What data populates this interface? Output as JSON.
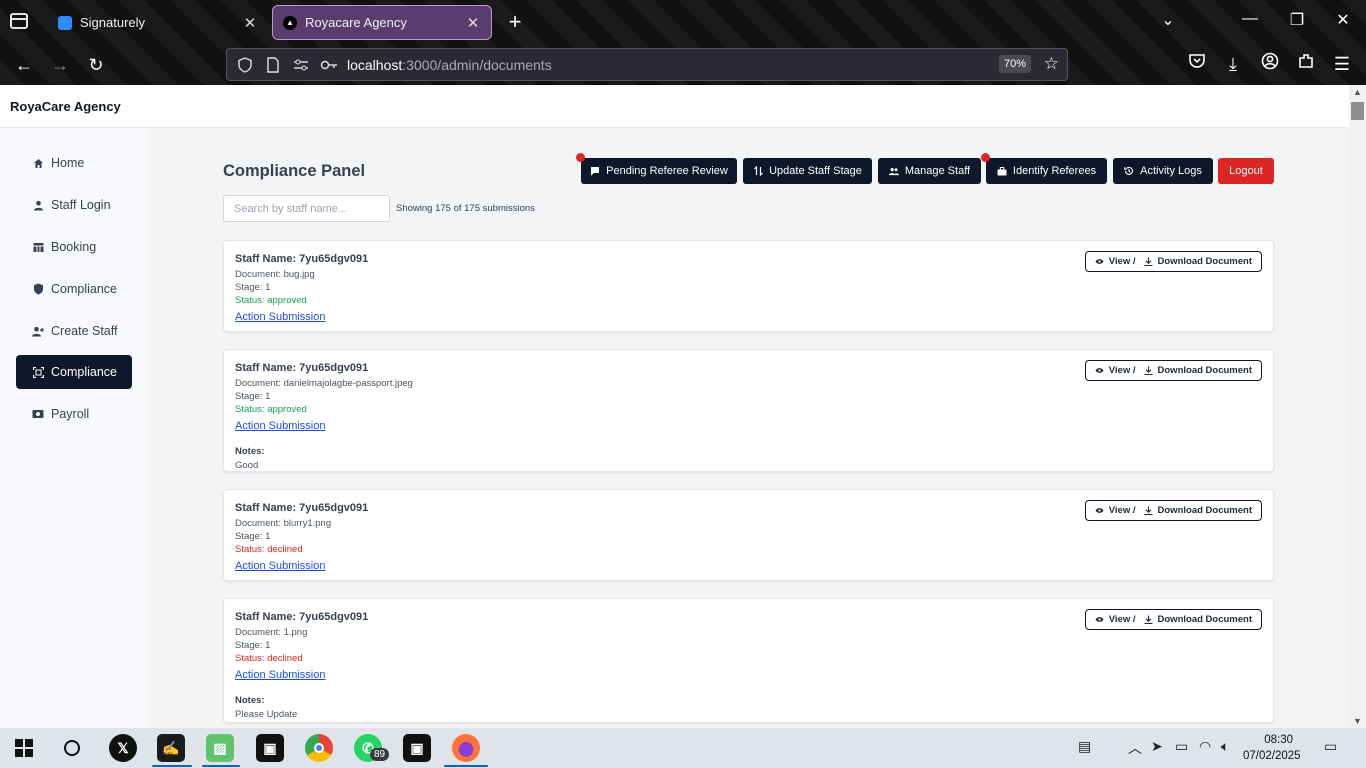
{
  "browser": {
    "tabs": [
      {
        "title": "Signaturely",
        "active": false,
        "favicon_color": "#2d8cff"
      },
      {
        "title": "Royacare Agency",
        "active": true,
        "favicon_color": "#000000"
      }
    ],
    "url_host": "localhost",
    "url_path": ":3000/admin/documents",
    "zoom": "70%"
  },
  "app": {
    "brand": "RoyaCare Agency"
  },
  "sidebar": {
    "items": [
      {
        "label": "Home",
        "icon": "home-icon",
        "active": false
      },
      {
        "label": "Staff Login",
        "icon": "user-icon",
        "active": false
      },
      {
        "label": "Booking",
        "icon": "table-icon",
        "active": false
      },
      {
        "label": "Compliance",
        "icon": "shield-icon",
        "active": false
      },
      {
        "label": "Create Staff",
        "icon": "user-plus-icon",
        "active": false
      },
      {
        "label": "Compliance",
        "icon": "scan-icon",
        "active": true
      },
      {
        "label": "Payroll",
        "icon": "money-icon",
        "active": false
      }
    ]
  },
  "main": {
    "title": "Compliance Panel",
    "toolbar": {
      "pending_referee_review": "Pending Referee Review",
      "update_staff_stage": "Update Staff Stage",
      "manage_staff": "Manage Staff",
      "identify_referees": "Identify Referees",
      "activity_logs": "Activity Logs",
      "logout": "Logout"
    },
    "search": {
      "placeholder": "Search by staff name...",
      "value": ""
    },
    "count_text": "Showing 175 of 175 submissions",
    "doc_button": {
      "view": "View /",
      "download": "Download Document"
    },
    "submissions": [
      {
        "staff": "Staff Name: 7yu65dgv091",
        "document": "Document: bug.jpg",
        "stage": "Stage: 1",
        "status": "Status: approved",
        "action": "Action Submission",
        "notes_label": "",
        "notes": ""
      },
      {
        "staff": "Staff Name: 7yu65dgv091",
        "document": "Document: danielmajolagbe-passport.jpeg",
        "stage": "Stage: 1",
        "status": "Status: approved",
        "action": "Action Submission",
        "notes_label": "Notes:",
        "notes": "Good"
      },
      {
        "staff": "Staff Name: 7yu65dgv091",
        "document": "Document: blurry1.png",
        "stage": "Stage: 1",
        "status": "Status: declined",
        "action": "Action Submission",
        "notes_label": "",
        "notes": ""
      },
      {
        "staff": "Staff Name: 7yu65dgv091",
        "document": "Document: 1.png",
        "stage": "Stage: 1",
        "status": "Status: declined",
        "action": "Action Submission",
        "notes_label": "Notes:",
        "notes": "Please Update"
      }
    ]
  },
  "taskbar": {
    "whatsapp_badge": "89",
    "time": "08:30",
    "date": "07/02/2025"
  },
  "colors": {
    "primary": "#0f172a",
    "danger": "#dc2626",
    "approved": "#16a34a",
    "tab_active": "#5a3c6e"
  }
}
